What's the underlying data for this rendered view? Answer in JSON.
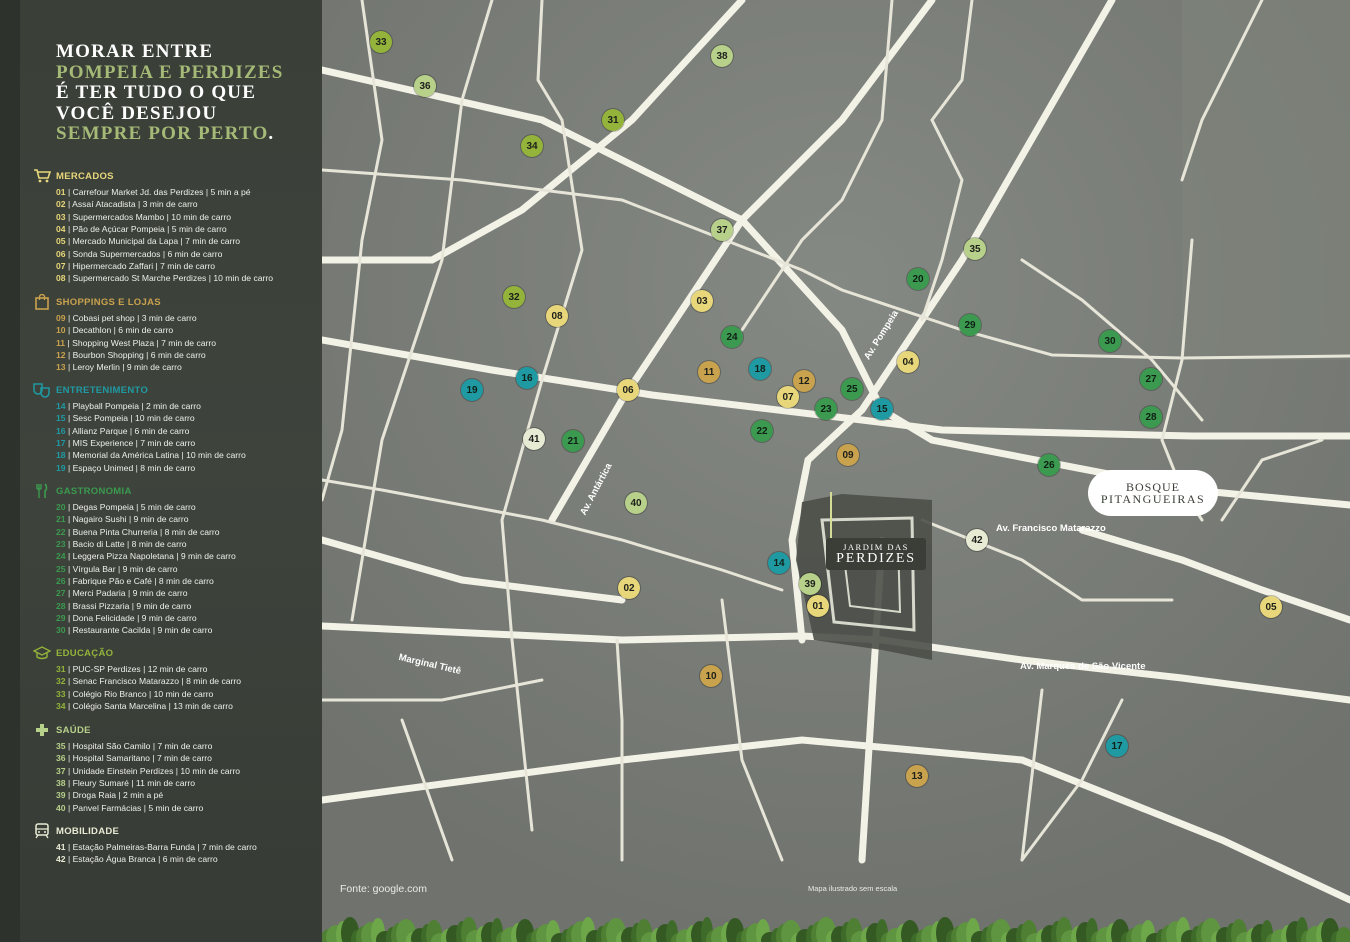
{
  "headline": {
    "line1": "MORAR ENTRE",
    "line2": "POMPEIA E PERDIZES",
    "line3": "É TER TUDO O QUE",
    "line4": "VOCÊ DESEJOU",
    "line5": "SEMPRE POR PERTO",
    "line5_end": "."
  },
  "colors": {
    "mercados": "#e8d77a",
    "shoppings": "#c9a24e",
    "entretenimento": "#1f9aa3",
    "gastronomia": "#3b9a4f",
    "educacao": "#93b33a",
    "saude": "#b7d08a",
    "mobilidade": "#e8ebd4",
    "headline_accent": "#a6ba77"
  },
  "categories": [
    {
      "key": "mercados",
      "icon": "cart-icon",
      "title": "MERCADOS",
      "items": [
        {
          "n": "01",
          "text": "| Carrefour Market Jd. das Perdizes | 5 min a pé"
        },
        {
          "n": "02",
          "text": "| Assaí Atacadista | 3 min de carro"
        },
        {
          "n": "03",
          "text": "| Supermercados Mambo | 10 min de carro"
        },
        {
          "n": "04",
          "text": "| Pão de Açúcar Pompeia | 5 min de carro"
        },
        {
          "n": "05",
          "text": "| Mercado Municipal da Lapa  | 7 min de carro"
        },
        {
          "n": "06",
          "text": "| Sonda Supermercados  | 6 min de carro"
        },
        {
          "n": "07",
          "text": "| Hipermercado Zaffari  | 7 min de carro"
        },
        {
          "n": "08",
          "text": "| Supermercado St Marche Perdizes | 10 min de carro"
        }
      ]
    },
    {
      "key": "shoppings",
      "icon": "shopping-bag-icon",
      "title": "SHOPPINGS E LOJAS",
      "items": [
        {
          "n": "09",
          "text": "| Cobasi pet shop | 3 min de carro"
        },
        {
          "n": "10",
          "text": "| Decathlon | 6 min de carro"
        },
        {
          "n": "11",
          "text": "| Shopping West Plaza | 7 min de carro"
        },
        {
          "n": "12",
          "text": "| Bourbon Shopping | 6 min de carro"
        },
        {
          "n": "13",
          "text": "| Leroy Merlin | 9 min de carro"
        }
      ]
    },
    {
      "key": "entretenimento",
      "icon": "theater-masks-icon",
      "title": "ENTRETENIMENTO",
      "items": [
        {
          "n": "14",
          "text": "| Playball Pompeia | 2 min de carro"
        },
        {
          "n": "15",
          "text": "| Sesc Pompeia | 10 min de carro"
        },
        {
          "n": "16",
          "text": "| Allianz Parque | 6 min de carro"
        },
        {
          "n": "17",
          "text": "| MIS Experience | 7 min de carro"
        },
        {
          "n": "18",
          "text": "| Memorial da América Latina | 10 min de carro"
        },
        {
          "n": "19",
          "text": "| Espaço Unimed | 8 min de carro"
        }
      ]
    },
    {
      "key": "gastronomia",
      "icon": "fork-knife-icon",
      "title": "GASTRONOMIA",
      "items": [
        {
          "n": "20",
          "text": "| Degas Pompeia | 5 min de carro"
        },
        {
          "n": "21",
          "text": "| Nagairo Sushi  | 9 min de carro"
        },
        {
          "n": "22",
          "text": "| Buena Pinta Churreria  | 8 min de carro"
        },
        {
          "n": "23",
          "text": "| Bacio di Latte  | 8 min de carro"
        },
        {
          "n": "24",
          "text": "| Leggera Pizza Napoletana  | 9 min de carro"
        },
        {
          "n": "25",
          "text": "| Vírgula Bar | 9 min de carro"
        },
        {
          "n": "26",
          "text": "| Fabrique Pão e Café | 8 min de carro"
        },
        {
          "n": "27",
          "text": "| Merci Padaria | 9 min de carro"
        },
        {
          "n": "28",
          "text": "| Brassi Pizzaria | 9 min de carro"
        },
        {
          "n": "29",
          "text": "| Dona Felicidade | 9 min de carro"
        },
        {
          "n": "30",
          "text": "| Restaurante Cacilda  | 9 min de carro"
        }
      ]
    },
    {
      "key": "educacao",
      "icon": "graduation-cap-icon",
      "title": "EDUCAÇÃO",
      "items": [
        {
          "n": "31",
          "text": "| PUC-SP Perdizes  | 12 min de carro"
        },
        {
          "n": "32",
          "text": "| Senac Francisco Matarazzo | 8 min de carro"
        },
        {
          "n": "33",
          "text": "| Colégio Rio Branco | 10 min de carro"
        },
        {
          "n": "34",
          "text": "| Colégio Santa Marcelina | 13 min de carro"
        }
      ]
    },
    {
      "key": "saude",
      "icon": "health-cross-icon",
      "title": "SAÚDE",
      "items": [
        {
          "n": "35",
          "text": "| Hospital São Camilo | 7 min de carro"
        },
        {
          "n": "36",
          "text": "| Hospital Samaritano | 7 min de carro"
        },
        {
          "n": "37",
          "text": "| Unidade Einstein Perdizes  | 10 min de carro"
        },
        {
          "n": "38",
          "text": "| Fleury  Sumaré | 11 min de carro"
        },
        {
          "n": "39",
          "text": "| Droga Raia | 2 min a pé"
        },
        {
          "n": "40",
          "text": "| Panvel Farmácias | 5 min de carro"
        }
      ]
    },
    {
      "key": "mobilidade",
      "icon": "train-icon",
      "title": "MOBILIDADE",
      "items": [
        {
          "n": "41",
          "text": "| Estação Palmeiras-Barra Funda | 7 min de carro"
        },
        {
          "n": "42",
          "text": "| Estação Água Branca | 6 min de carro"
        }
      ]
    }
  ],
  "map": {
    "roads": {
      "pompeia": "Av. Pompeia",
      "antartica": "Av. Antártica",
      "matarazzo": "Av. Francisco Matarazzo",
      "sao_vicente": "Av. Marquês de São Vicente",
      "tiete": "Marginal Tietê"
    },
    "logo_bosque": {
      "line1": "BOSQUE",
      "line2": "PITANGUEIRAS"
    },
    "logo_jardim": {
      "line1": "JARDIM DAS",
      "line2": "PERDIZES"
    },
    "pins": [
      {
        "n": "01",
        "cat": "mercados"
      },
      {
        "n": "02",
        "cat": "mercados"
      },
      {
        "n": "03",
        "cat": "mercados"
      },
      {
        "n": "04",
        "cat": "mercados"
      },
      {
        "n": "05",
        "cat": "mercados"
      },
      {
        "n": "06",
        "cat": "mercados"
      },
      {
        "n": "07",
        "cat": "mercados"
      },
      {
        "n": "08",
        "cat": "mercados"
      },
      {
        "n": "09",
        "cat": "shoppings"
      },
      {
        "n": "10",
        "cat": "shoppings"
      },
      {
        "n": "11",
        "cat": "shoppings"
      },
      {
        "n": "12",
        "cat": "shoppings"
      },
      {
        "n": "13",
        "cat": "shoppings"
      },
      {
        "n": "14",
        "cat": "entretenimento"
      },
      {
        "n": "15",
        "cat": "entretenimento"
      },
      {
        "n": "16",
        "cat": "entretenimento"
      },
      {
        "n": "17",
        "cat": "entretenimento"
      },
      {
        "n": "18",
        "cat": "entretenimento"
      },
      {
        "n": "19",
        "cat": "entretenimento"
      },
      {
        "n": "20",
        "cat": "gastronomia"
      },
      {
        "n": "21",
        "cat": "gastronomia"
      },
      {
        "n": "22",
        "cat": "gastronomia"
      },
      {
        "n": "23",
        "cat": "gastronomia"
      },
      {
        "n": "24",
        "cat": "gastronomia"
      },
      {
        "n": "25",
        "cat": "gastronomia"
      },
      {
        "n": "26",
        "cat": "gastronomia"
      },
      {
        "n": "27",
        "cat": "gastronomia"
      },
      {
        "n": "28",
        "cat": "gastronomia"
      },
      {
        "n": "29",
        "cat": "gastronomia"
      },
      {
        "n": "30",
        "cat": "gastronomia"
      },
      {
        "n": "31",
        "cat": "educacao"
      },
      {
        "n": "32",
        "cat": "educacao"
      },
      {
        "n": "33",
        "cat": "educacao"
      },
      {
        "n": "34",
        "cat": "educacao"
      },
      {
        "n": "35",
        "cat": "saude"
      },
      {
        "n": "36",
        "cat": "saude"
      },
      {
        "n": "37",
        "cat": "saude"
      },
      {
        "n": "38",
        "cat": "saude"
      },
      {
        "n": "39",
        "cat": "saude"
      },
      {
        "n": "40",
        "cat": "saude"
      },
      {
        "n": "41",
        "cat": "mobilidade"
      },
      {
        "n": "42",
        "cat": "mobilidade"
      }
    ]
  },
  "source": "Fonte: google.com",
  "scale_note": "Mapa ilustrado sem escala"
}
